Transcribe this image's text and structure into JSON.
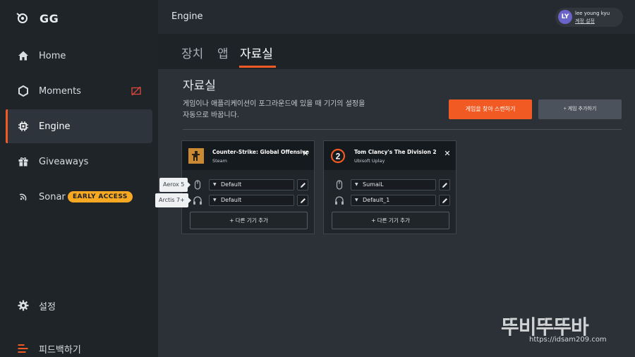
{
  "brand": {
    "name": "GG"
  },
  "sidebar": {
    "items": [
      {
        "label": "Home",
        "icon": "home-icon"
      },
      {
        "label": "Moments",
        "icon": "moments-icon"
      },
      {
        "label": "Engine",
        "icon": "engine-chip-icon"
      },
      {
        "label": "Giveaways",
        "icon": "gift-icon"
      },
      {
        "label": "Sonar",
        "icon": "sonar-icon",
        "badge": "EARLY ACCESS"
      }
    ],
    "settings_label": "설정",
    "feedback_label": "피드백하기"
  },
  "header": {
    "title": "Engine",
    "user": {
      "initials": "LY",
      "name": "lee young kyu",
      "link": "계정 설정"
    }
  },
  "tabs": [
    {
      "label": "장치"
    },
    {
      "label": "앱"
    },
    {
      "label": "자료실"
    }
  ],
  "library": {
    "title": "자료실",
    "description_line1": "게임이나 애플리케이션이 포그라운드에 있을 때 기기의 설정을",
    "description_line2": "자동으로 바꿉니다.",
    "scan_button": "게임을 찾아 스캔하기",
    "add_game_button": "+ 게임 추가하기"
  },
  "games": [
    {
      "name": "Counter-Strike: Global Offensive",
      "platform": "Steam",
      "devices": [
        {
          "icon": "mouse-icon",
          "value": "Default",
          "tooltip": "Aerox 5"
        },
        {
          "icon": "headset-icon",
          "value": "Default",
          "tooltip": "Arctis 7+"
        }
      ],
      "add_device": "+ 다른 기기 추가"
    },
    {
      "name": "Tom Clancy's The Division 2",
      "platform": "Ubisoft Uplay",
      "devices": [
        {
          "icon": "mouse-icon",
          "value": "SumaiL"
        },
        {
          "icon": "headset-icon",
          "value": "Default_1"
        }
      ],
      "add_device": "+ 다른 기기 추가"
    }
  ],
  "watermark": {
    "main": "뚜비뚜뚜바",
    "sub": "https://idsam209.com"
  },
  "colors": {
    "accent": "#f15a22",
    "badge": "#f7a823",
    "sidebar_bg": "#1f2429",
    "content_bg": "#2c3138",
    "avatar": "#6a64c8"
  }
}
